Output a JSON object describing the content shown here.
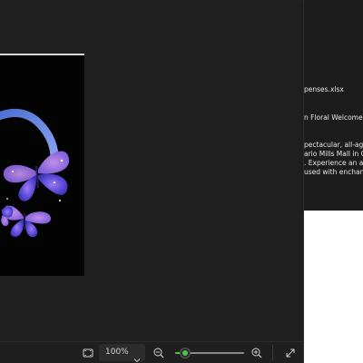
{
  "viewer": {
    "zoom_value": "100%",
    "zoom_level": 0.15,
    "icons": {
      "fit": "fit-to-window-icon",
      "zoom_dropdown": "chevron-down-icon",
      "zoom_out": "zoom-out-icon",
      "zoom_in": "zoom-in-icon",
      "fullscreen": "fullscreen-icon"
    },
    "colors": {
      "background": "#202020",
      "accent": "#4cc24c"
    }
  },
  "right_panel": {
    "lines": [
      "penses.xlsx",
      "n Floral Welcome Oc",
      "pectacular, all-ages w",
      "ario Mills Mall in Ont",
      ". Experience an all-ne",
      "used with enchan.pd"
    ]
  }
}
